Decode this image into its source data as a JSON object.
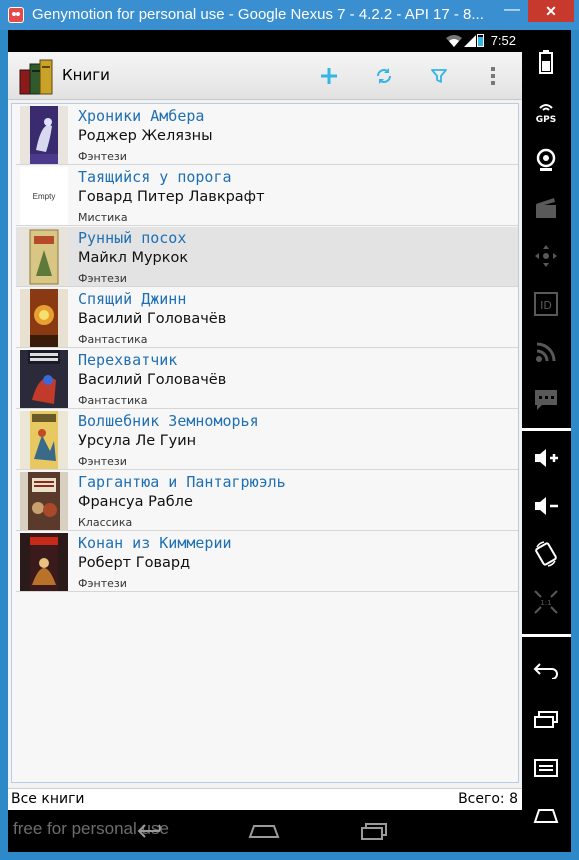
{
  "window": {
    "title": "Genymotion for personal use - Google Nexus 7 - 4.2.2 - API 17 - 8...",
    "minimize_glyph": "—",
    "close_glyph": "✕"
  },
  "status_bar": {
    "time": "7:52"
  },
  "action_bar": {
    "title": "Книги",
    "actions": [
      "add-icon",
      "refresh-icon",
      "filter-icon",
      "overflow-menu-icon"
    ],
    "accent_color": "#33b5e5"
  },
  "books": [
    {
      "title": "Хроники Амбера",
      "author": "Роджер Желязны",
      "genre": "Фэнтези",
      "cover": "image"
    },
    {
      "title": "Таящийся у порога",
      "author": "Говард Питер Лавкрафт",
      "genre": "Мистика",
      "cover": "empty",
      "cover_text": "Empty"
    },
    {
      "title": "Рунный посох",
      "author": "Майкл Муркок",
      "genre": "Фэнтези",
      "cover": "image",
      "selected": true
    },
    {
      "title": "Спящий Джинн",
      "author": "Василий Головачёв",
      "genre": "Фантастика",
      "cover": "image"
    },
    {
      "title": "Перехватчик",
      "author": "Василий Головачёв",
      "genre": "Фантастика",
      "cover": "image"
    },
    {
      "title": "Волшебник Земноморья",
      "author": "Урсула Ле Гуин",
      "genre": "Фэнтези",
      "cover": "image"
    },
    {
      "title": "Гаргантюа и Пантагрюэль",
      "author": "Франсуа Рабле",
      "genre": "Классика",
      "cover": "image"
    },
    {
      "title": "Конан из Киммерии",
      "author": "Роберт Говард",
      "genre": "Фэнтези",
      "cover": "image"
    }
  ],
  "footer": {
    "left": "Все книги",
    "right": "Всего: 8"
  },
  "nav_bar": {
    "watermark": "free for personal use"
  },
  "side_panel": {
    "buttons": [
      "battery-icon",
      "gps-icon",
      "webcam-icon",
      "video-capture-icon",
      "dpad-icon",
      "device-id-icon",
      "rss-icon",
      "sms-icon",
      "volume-up-icon",
      "volume-down-icon",
      "rotate-icon",
      "scale-icon",
      "back-icon",
      "recent-apps-icon",
      "menu-icon",
      "home-icon"
    ],
    "gps_label": "GPS",
    "id_label": "ID"
  }
}
